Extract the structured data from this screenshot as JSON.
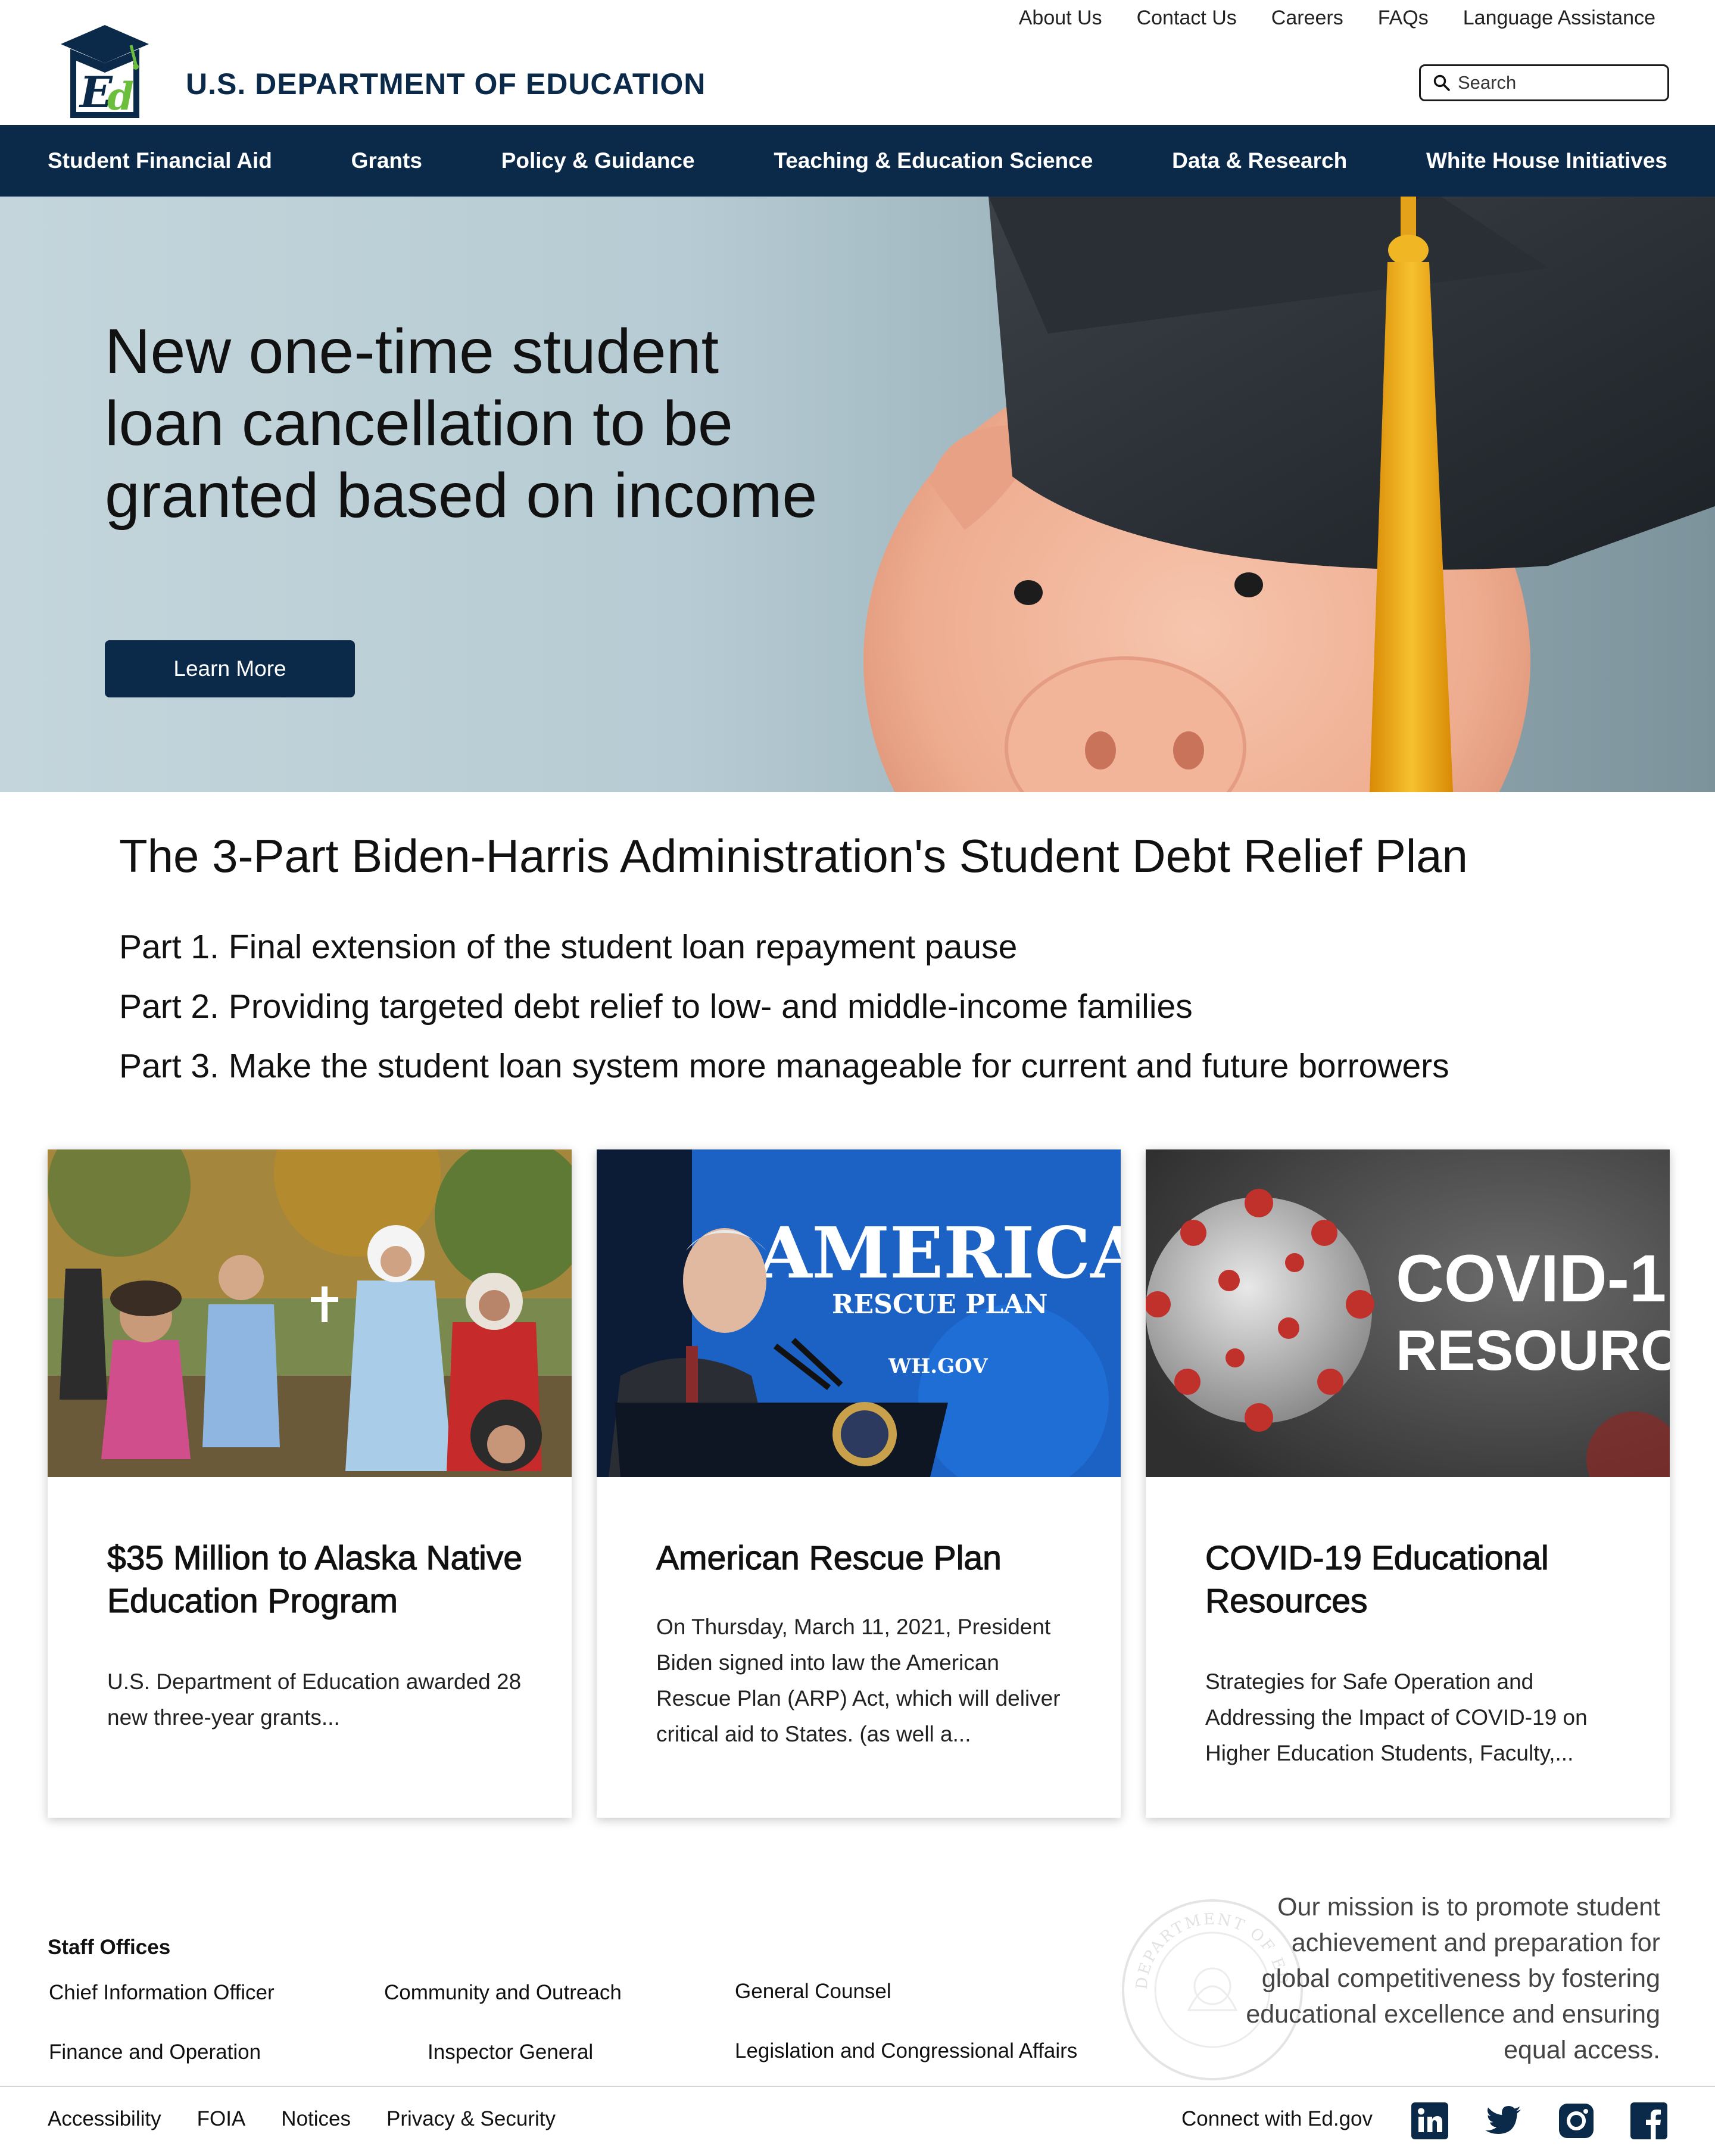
{
  "utility_nav": [
    "About Us",
    "Contact Us",
    "Careers",
    "FAQs",
    "Language Assistance"
  ],
  "agency_name": "U.S. DEPARTMENT OF EDUCATION",
  "search": {
    "placeholder": "Search"
  },
  "main_nav": [
    "Student Financial Aid",
    "Grants",
    "Policy & Guidance",
    "Teaching & Education Science",
    "Data & Research",
    "White House Initiatives"
  ],
  "hero": {
    "title": "New one-time student loan cancellation to be granted based on income",
    "button": "Learn More"
  },
  "plan": {
    "title": "The 3-Part Biden-Harris Administration's Student Debt Relief Plan",
    "parts": [
      "Part 1. Final extension of the student loan repayment pause",
      "Part 2. Providing targeted debt relief to low- and middle-income families",
      "Part 3. Make the student loan system more manageable for current and future borrowers"
    ]
  },
  "cards": [
    {
      "title": "$35 Million to Alaska Native Education Program",
      "text": "U.S. Department of Education awarded 28 new three-year grants..."
    },
    {
      "title": "American Rescue Plan",
      "text": "On Thursday, March 11, 2021, President Biden signed into law the American Rescue Plan (ARP) Act, which will deliver critical aid to States.  (as well a...",
      "image_text": {
        "line1": "AMERICAN",
        "line2": "RESCUE PLAN",
        "line3": "WH.GOV"
      }
    },
    {
      "title": "COVID-19 Educational Resources",
      "text": "Strategies for Safe Operation and Addressing the Impact of COVID-19 on Higher Education Students, Faculty,...",
      "image_text": {
        "line1": "COVID-1",
        "line2": "RESOURCE"
      }
    }
  ],
  "footer": {
    "staff_heading": "Staff Offices",
    "staff_links": [
      "Chief Information Officer",
      "Community and Outreach",
      "General Counsel",
      "Finance and Operation",
      "Inspector General",
      "Legislation and Congressional Affairs"
    ],
    "mission": "Our mission is to promote student achievement and preparation for global competitiveness by fostering educational excellence and ensuring equal access.",
    "seal_text": "DEPARTMENT OF EDUCATION",
    "bottom_links": [
      "Accessibility",
      "FOIA",
      "Notices",
      "Privacy & Security"
    ],
    "connect": "Connect with Ed.gov",
    "social_icons": [
      "linkedin-icon",
      "twitter-icon",
      "instagram-icon",
      "facebook-icon"
    ]
  },
  "colors": {
    "navy": "#0b2a4a",
    "logo_green": "#6cbf3c",
    "tassel": "#f2b01e"
  }
}
